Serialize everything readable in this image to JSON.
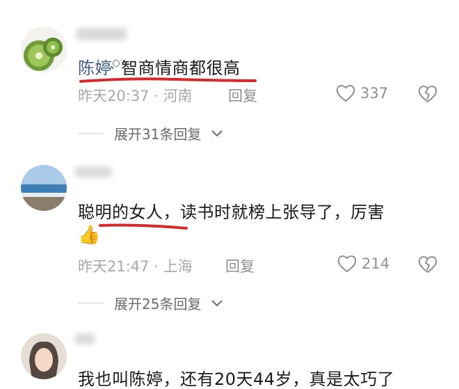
{
  "comments": [
    {
      "mention": "陈婷",
      "text": "智商情商都很高",
      "time_location": "昨天20:37 · 河南",
      "reply_label": "回复",
      "likes": "337",
      "expand_label": "展开31条回复"
    },
    {
      "text": "聪明的女人，读书时就榜上张导了，厉害",
      "emoji": "👍",
      "time_location": "昨天21:47 · 上海",
      "reply_label": "回复",
      "likes": "214",
      "expand_label": "展开25条回复"
    },
    {
      "text": "我也叫陈婷，还有20天44岁，真是太巧了"
    }
  ],
  "colors": {
    "mention": "#3e5b87",
    "underline": "#d42a2a",
    "meta": "#a8a8a8"
  },
  "icons": [
    "heart-icon",
    "broken-heart-icon",
    "chevron-down-icon",
    "search-icon",
    "thumbs-up-emoji"
  ]
}
